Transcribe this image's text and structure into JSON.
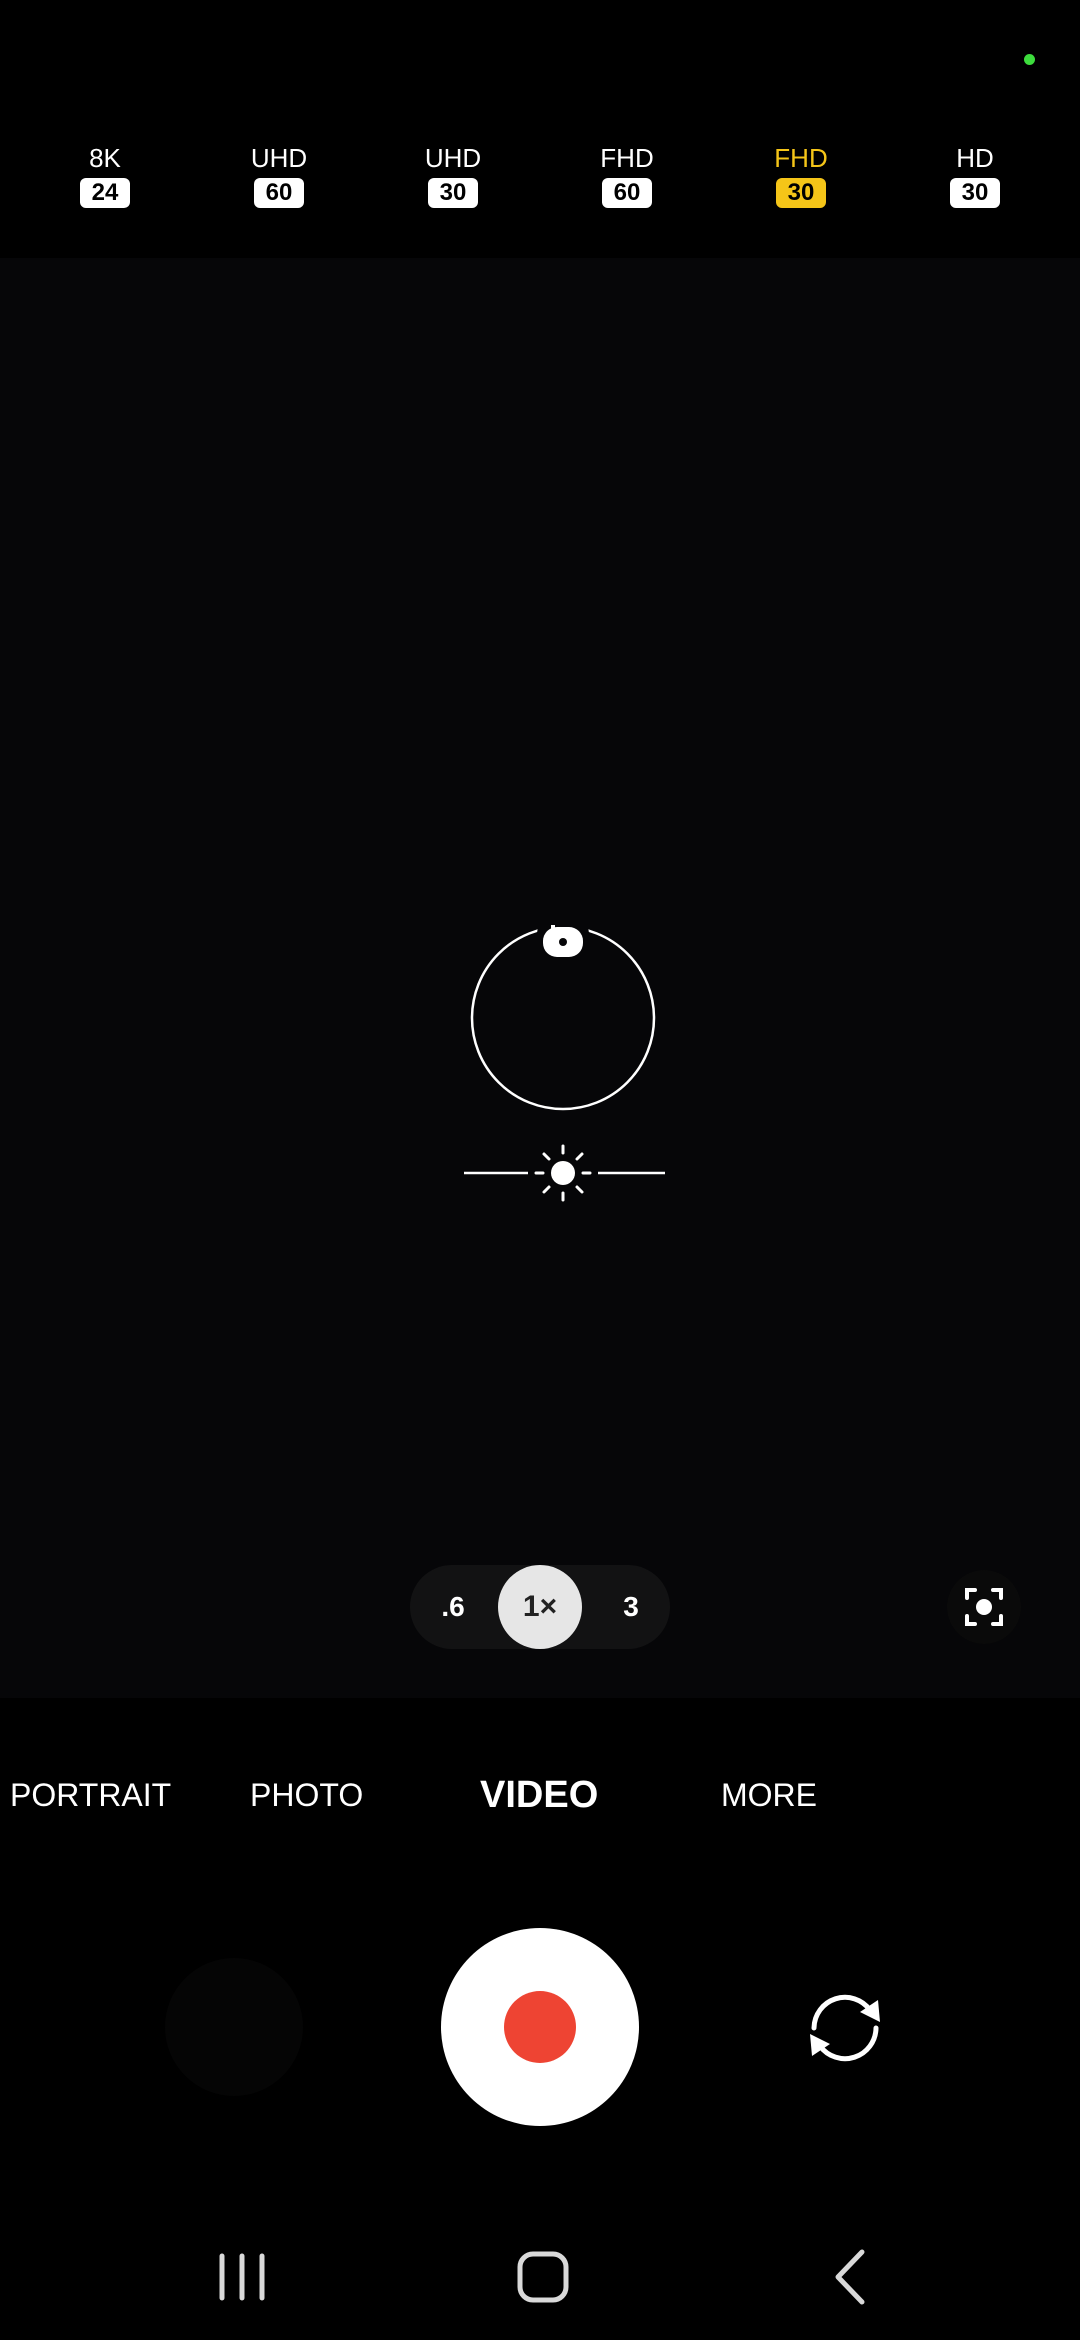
{
  "status": {
    "privacy_indicator_color": "#3ddc3d"
  },
  "resolution_options": [
    {
      "label": "8K",
      "fps": "24",
      "selected": false
    },
    {
      "label": "UHD",
      "fps": "60",
      "selected": false
    },
    {
      "label": "UHD",
      "fps": "30",
      "selected": false
    },
    {
      "label": "FHD",
      "fps": "60",
      "selected": false
    },
    {
      "label": "FHD",
      "fps": "30",
      "selected": true
    },
    {
      "label": "HD",
      "fps": "30",
      "selected": false
    }
  ],
  "viewfinder": {
    "focus_icon": "unlock-icon",
    "exposure_icon": "sun-icon"
  },
  "zoom": {
    "options": [
      ".6",
      "1×",
      "3"
    ],
    "selected": "1×"
  },
  "modes": {
    "portrait": "PORTRAIT",
    "photo": "PHOTO",
    "video": "VIDEO",
    "more": "MORE",
    "selected": "VIDEO"
  },
  "controls": {
    "record_color": "#ee4433",
    "flip_icon": "switch-camera-icon",
    "scene_icon": "scene-optimizer-icon"
  },
  "colors": {
    "selected_accent": "#f5c518"
  },
  "nav": {
    "recents_icon": "recents-icon",
    "home_icon": "home-icon",
    "back_icon": "back-icon"
  }
}
